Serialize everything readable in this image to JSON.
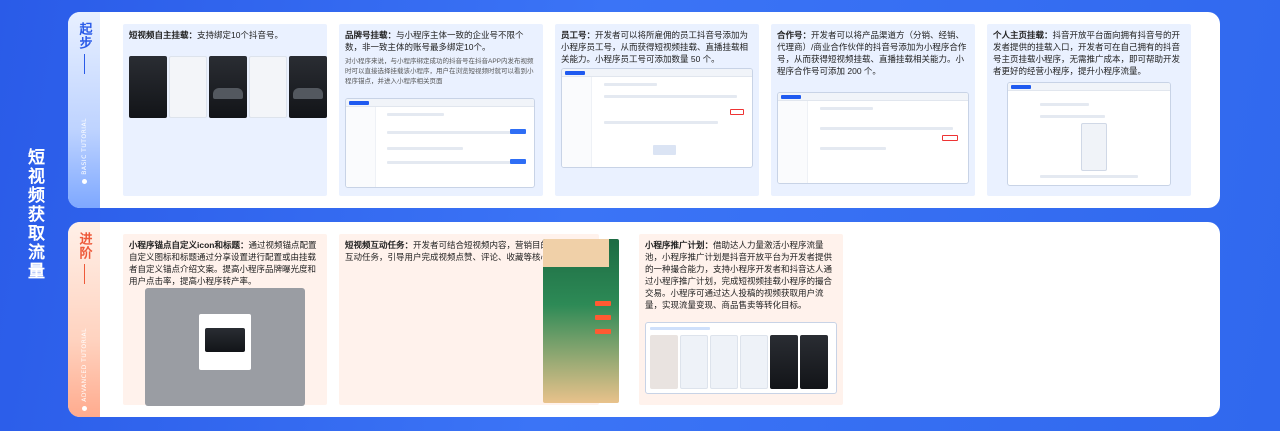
{
  "main_title": "短视频获取流量",
  "sections": {
    "basic": {
      "label_cn": "起步",
      "label_en": "BASIC TUTORIAL",
      "cards": [
        {
          "title": "短视频自主挂载：",
          "desc": "支持绑定10个抖音号。"
        },
        {
          "title": "品牌号挂载：",
          "desc": "与小程序主体一致的企业号不限个数，非一致主体的账号最多绑定10个。",
          "sub": "对小程序来说，与小程序绑定成功的抖音号在抖音APP内发布视频时可以直接选择挂载该小程序，用户在浏览短视频时就可以看到小程序锚点，并进入小程序相关页面"
        },
        {
          "title": "员工号：",
          "desc": "开发者可以将所雇佣的员工抖音号添加为小程序员工号，从而获得短视频挂载、直播挂载相关能力。小程序员工号可添加数量 50 个。"
        },
        {
          "title": "合作号：",
          "desc": "开发者可以将产品渠道方（分销、经销、代理商）/商业合作伙伴的抖音号添加为小程序合作号，从而获得短视频挂载、直播挂载相关能力。小程序合作号可添加 200 个。"
        },
        {
          "title": "个人主页挂载：",
          "desc": "抖音开放平台面向拥有抖音号的开发者提供的挂载入口，开发者可在自己拥有的抖音号主页挂载小程序，无需推广成本，即可帮助开发者更好的经营小程序，提升小程序流量。"
        }
      ]
    },
    "advanced": {
      "label_cn": "进阶",
      "label_en": "ADVANCED TUTORIAL",
      "cards": [
        {
          "title": "小程序锚点自定义icon和标题：",
          "desc": "通过视频锚点配置自定义图标和标题通过分享设置进行配置或由挂载者自定义锚点介绍文案。提高小程序品牌曝光度和用户点击率，提高小程序转产率。"
        },
        {
          "title": "短视频互动任务：",
          "desc": "开发者可结合短视频内容，营销目的打造定制化互动任务，引导用户完成视频点赞、评论、收藏等核心行为转化。"
        },
        {
          "title": "小程序推广计划：",
          "desc": "借助达人力量激活小程序流量池，小程序推广计划是抖音开放平台为开发者提供的一种撮合能力，支持小程序开发者和抖音达人通过小程序推广计划，完成短视频挂载小程序的撮合交易。小程序可通过达人投稿的视频获取用户流量，实现流量变现、商品售卖等转化目标。"
        }
      ]
    }
  },
  "colors": {
    "background": "#2f66f0",
    "basic_accent": "#2a5be8",
    "advanced_accent": "#ee5a3a",
    "basic_card_bg": "#eaf1ff",
    "advanced_card_bg": "#fff2ec"
  }
}
